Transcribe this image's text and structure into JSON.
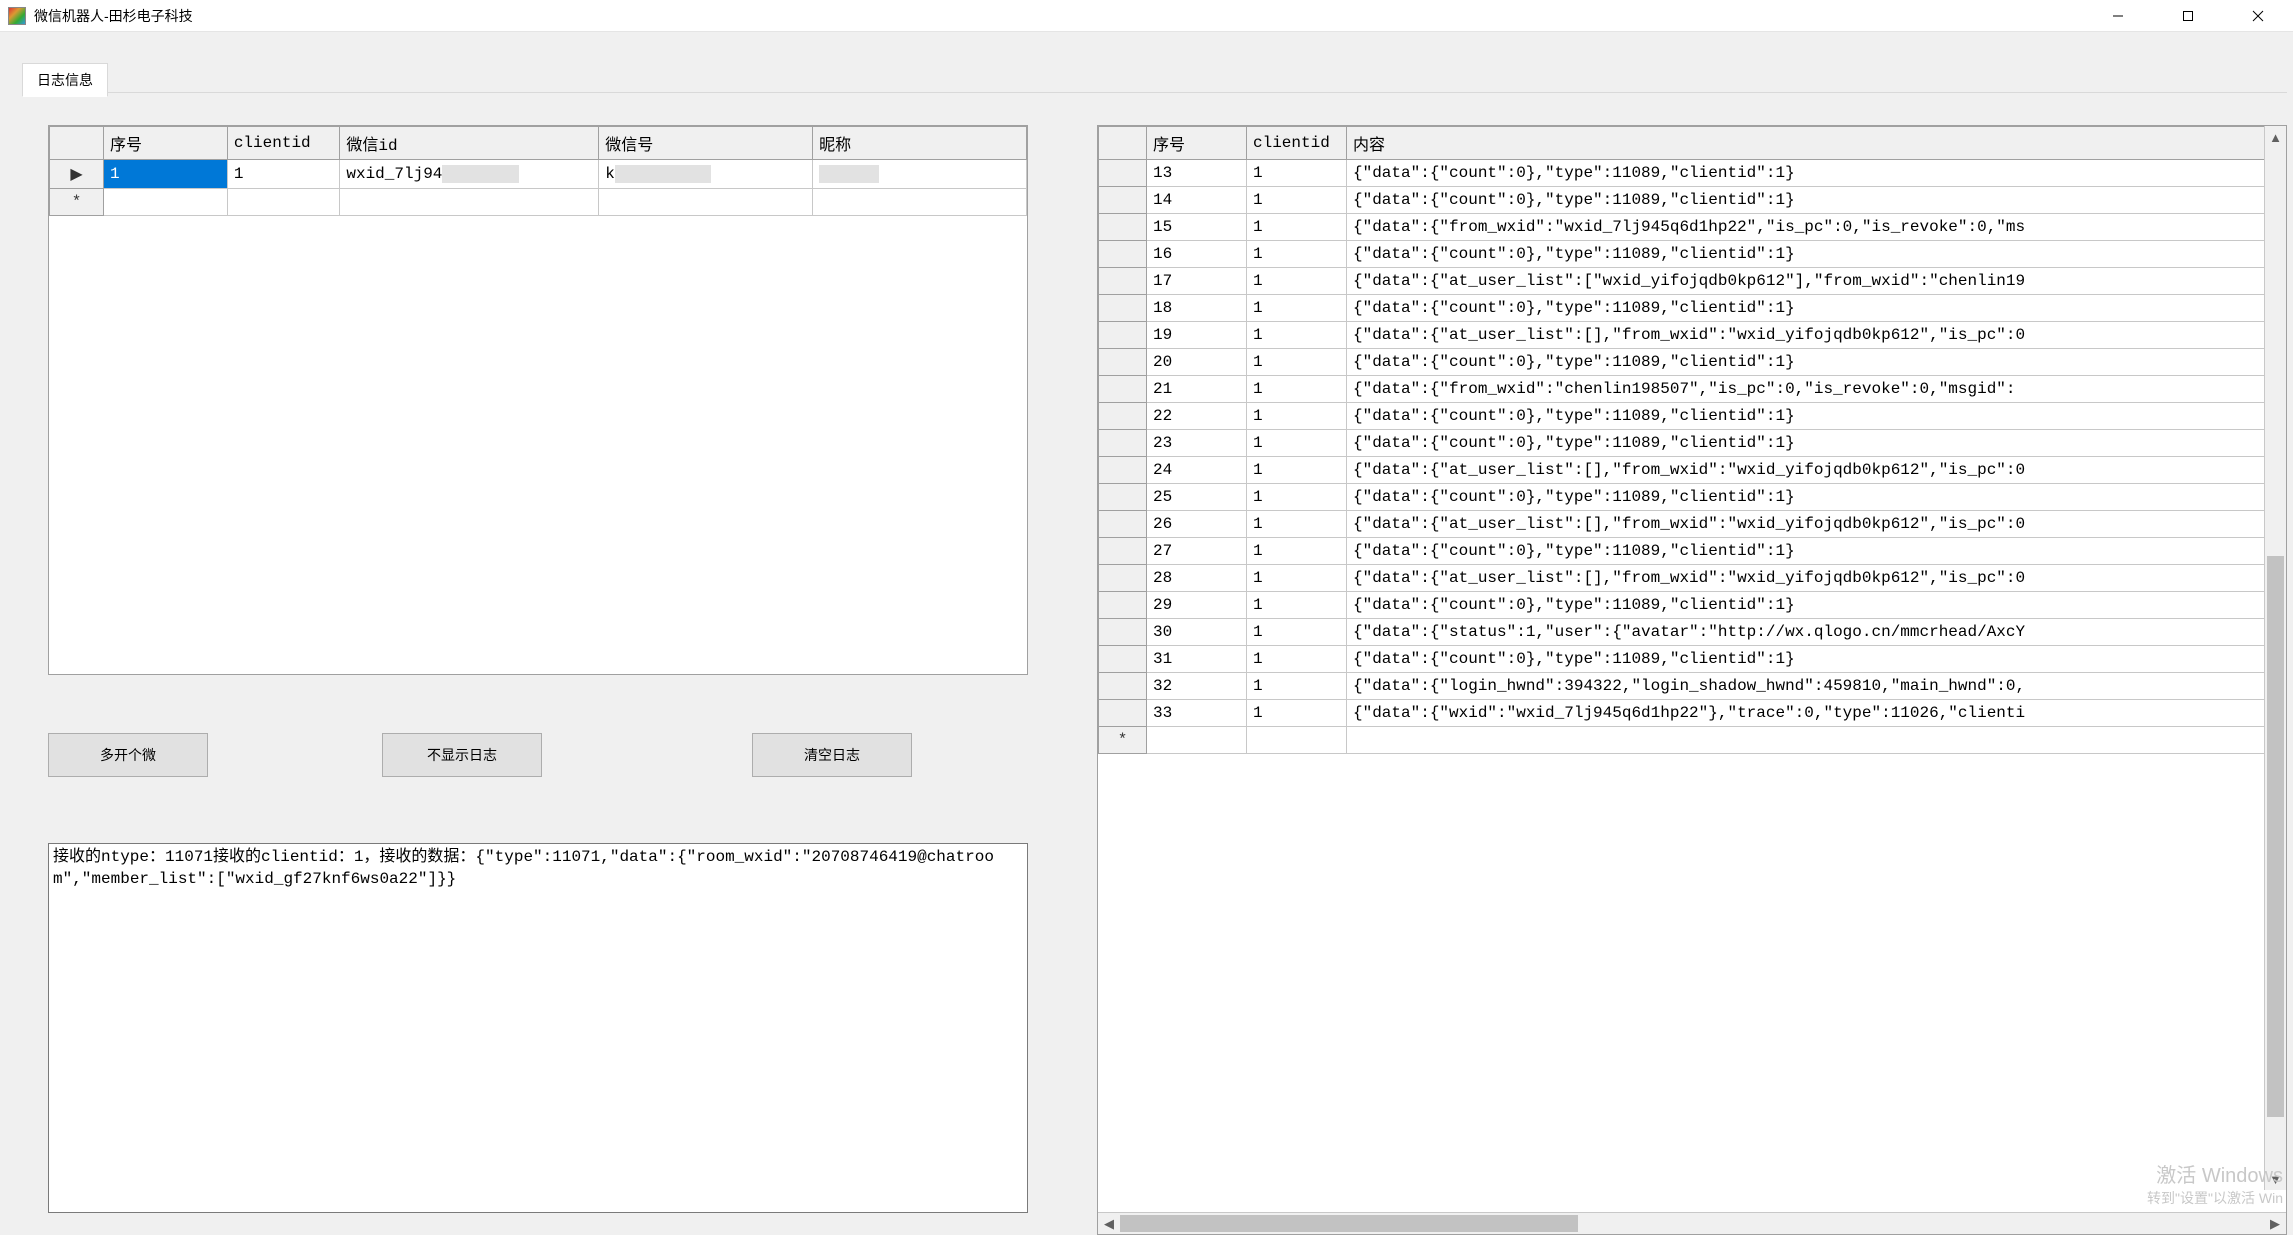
{
  "window": {
    "title": "微信机器人-田杉电子科技"
  },
  "tab": {
    "label": "日志信息"
  },
  "leftGrid": {
    "headers": {
      "seq": "序号",
      "clientid": "clientid",
      "wxid": "微信id",
      "wxno": "微信号",
      "nick": "昵称"
    },
    "rows": [
      {
        "indicator": "▶",
        "seq": "1",
        "clientid": "1",
        "wxid_prefix": "wxid_7lj94",
        "wxno_prefix": "k",
        "nick": ""
      }
    ],
    "newrow_indicator": "*"
  },
  "buttons": {
    "multi": "多开个微",
    "hidelog": "不显示日志",
    "clearlog": "清空日志"
  },
  "logtext": "接收的ntype：11071接收的clientid：1，接收的数据：{\"type\":11071,\"data\":{\"room_wxid\":\"20708746419@chatroom\",\"member_list\":[\"wxid_gf27knf6ws0a22\"]}}",
  "rightGrid": {
    "headers": {
      "seq": "序号",
      "clientid": "clientid",
      "content": "内容"
    },
    "rows": [
      {
        "seq": "13",
        "clientid": "1",
        "content": "{\"data\":{\"count\":0},\"type\":11089,\"clientid\":1}"
      },
      {
        "seq": "14",
        "clientid": "1",
        "content": "{\"data\":{\"count\":0},\"type\":11089,\"clientid\":1}"
      },
      {
        "seq": "15",
        "clientid": "1",
        "content": "{\"data\":{\"from_wxid\":\"wxid_7lj945q6d1hp22\",\"is_pc\":0,\"is_revoke\":0,\"ms"
      },
      {
        "seq": "16",
        "clientid": "1",
        "content": "{\"data\":{\"count\":0},\"type\":11089,\"clientid\":1}"
      },
      {
        "seq": "17",
        "clientid": "1",
        "content": "{\"data\":{\"at_user_list\":[\"wxid_yifojqdb0kp612\"],\"from_wxid\":\"chenlin19"
      },
      {
        "seq": "18",
        "clientid": "1",
        "content": "{\"data\":{\"count\":0},\"type\":11089,\"clientid\":1}"
      },
      {
        "seq": "19",
        "clientid": "1",
        "content": "{\"data\":{\"at_user_list\":[],\"from_wxid\":\"wxid_yifojqdb0kp612\",\"is_pc\":0"
      },
      {
        "seq": "20",
        "clientid": "1",
        "content": "{\"data\":{\"count\":0},\"type\":11089,\"clientid\":1}"
      },
      {
        "seq": "21",
        "clientid": "1",
        "content": "{\"data\":{\"from_wxid\":\"chenlin198507\",\"is_pc\":0,\"is_revoke\":0,\"msgid\":"
      },
      {
        "seq": "22",
        "clientid": "1",
        "content": "{\"data\":{\"count\":0},\"type\":11089,\"clientid\":1}"
      },
      {
        "seq": "23",
        "clientid": "1",
        "content": "{\"data\":{\"count\":0},\"type\":11089,\"clientid\":1}"
      },
      {
        "seq": "24",
        "clientid": "1",
        "content": "{\"data\":{\"at_user_list\":[],\"from_wxid\":\"wxid_yifojqdb0kp612\",\"is_pc\":0"
      },
      {
        "seq": "25",
        "clientid": "1",
        "content": "{\"data\":{\"count\":0},\"type\":11089,\"clientid\":1}"
      },
      {
        "seq": "26",
        "clientid": "1",
        "content": "{\"data\":{\"at_user_list\":[],\"from_wxid\":\"wxid_yifojqdb0kp612\",\"is_pc\":0"
      },
      {
        "seq": "27",
        "clientid": "1",
        "content": "{\"data\":{\"count\":0},\"type\":11089,\"clientid\":1}"
      },
      {
        "seq": "28",
        "clientid": "1",
        "content": "{\"data\":{\"at_user_list\":[],\"from_wxid\":\"wxid_yifojqdb0kp612\",\"is_pc\":0"
      },
      {
        "seq": "29",
        "clientid": "1",
        "content": "{\"data\":{\"count\":0},\"type\":11089,\"clientid\":1}"
      },
      {
        "seq": "30",
        "clientid": "1",
        "content": "{\"data\":{\"status\":1,\"user\":{\"avatar\":\"http://wx.qlogo.cn/mmcrhead/AxcY"
      },
      {
        "seq": "31",
        "clientid": "1",
        "content": "{\"data\":{\"count\":0},\"type\":11089,\"clientid\":1}"
      },
      {
        "seq": "32",
        "clientid": "1",
        "content": "{\"data\":{\"login_hwnd\":394322,\"login_shadow_hwnd\":459810,\"main_hwnd\":0,"
      },
      {
        "seq": "33",
        "clientid": "1",
        "content": "{\"data\":{\"wxid\":\"wxid_7lj945q6d1hp22\"},\"trace\":0,\"type\":11026,\"clienti"
      }
    ],
    "newrow_indicator": "*"
  },
  "watermark": {
    "line1": "激活 Windows",
    "line2": "转到\"设置\"以激活 Win"
  }
}
